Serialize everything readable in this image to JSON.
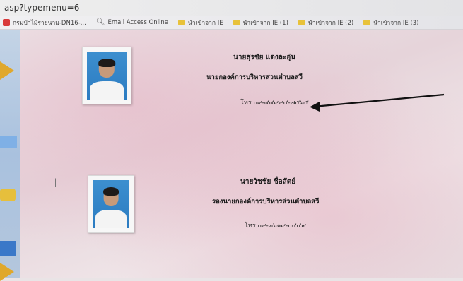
{
  "browser": {
    "url_text": "asp?typemenu=6",
    "bookmarks": [
      {
        "label": "กรมป้าไม้รายนาม-DN16-...",
        "icon": "red-site-icon"
      },
      {
        "label": "Email Access Online",
        "icon": "search-icon"
      },
      {
        "label": "นำเข้าจาก IE",
        "icon": "folder-icon"
      },
      {
        "label": "นำเข้าจาก IE (1)",
        "icon": "folder-icon"
      },
      {
        "label": "นำเข้าจาก IE (2)",
        "icon": "folder-icon"
      },
      {
        "label": "นำเข้าจาก IE (3)",
        "icon": "folder-icon"
      }
    ]
  },
  "staff": [
    {
      "name": "นายสุรชัย แดงละอุ่น",
      "position": "นายกองค์การบริหารส่วนตำบลสวี",
      "phone": "โทร ๐๙-๔๔๙๙๔-๗๕๖๕"
    },
    {
      "name": "นายวัชชัย ชื่อสัตย์",
      "position": "รองนายกองค์การบริหารส่วนตำบลสวี",
      "phone": "โทร ๐๙-๓๖๑๙-๐๔๔๙"
    }
  ],
  "colors": {
    "arrow": "#111111",
    "photo_bg": "#2f82c6"
  }
}
